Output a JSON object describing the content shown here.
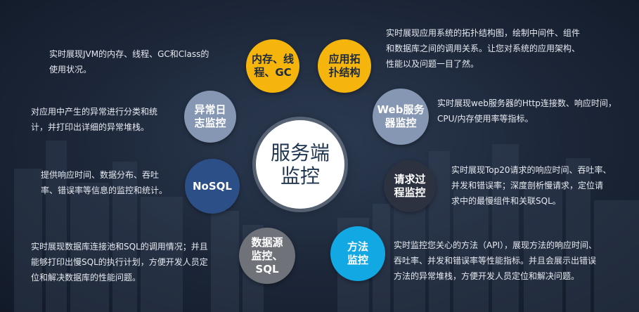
{
  "center": {
    "label": "服务端\n监控"
  },
  "colors": {
    "yellow": "#f5b50c",
    "steel": "#8697b3",
    "navy": "#2d4f88",
    "dark": "#2c3240",
    "cyan": "#12a8e4",
    "gray": "#6f7278"
  },
  "nodes": [
    {
      "id": "memory",
      "label": "内存、线\n程、GC",
      "color": "yellow",
      "text_color": "#1d2a3c",
      "desc": "实时展现JVM的内存、线程、GC和Class的\n使用状况。"
    },
    {
      "id": "topology",
      "label": "应用拓\n扑结构",
      "color": "yellow",
      "text_color": "#1d2a3c",
      "desc": "实时展现应用系统的拓扑结构图，绘制中间件、组件\n和数据库之间的调用关系。让您对系统的应用架构、\n性能以及问题一目了然。"
    },
    {
      "id": "exception-log",
      "label": "异常日\n志监控",
      "color": "steel",
      "text_color": "#ffffff",
      "desc": "对应用中产生的异常进行分类和统\n计，并打印出详细的异常堆栈。"
    },
    {
      "id": "web-server",
      "label": "Web服务\n器监控",
      "color": "steel",
      "text_color": "#ffffff",
      "desc": "实时展现web服务器的Http连接数、响应时间，\nCPU/内存使用率等指标。"
    },
    {
      "id": "nosql",
      "label": "NoSQL",
      "color": "navy",
      "text_color": "#ffffff",
      "desc": "提供响应时间、数据分布、吞吐\n率、错误率等信息的监控和统计。"
    },
    {
      "id": "request-process",
      "label": "请求过\n程监控",
      "color": "dark",
      "text_color": "#ffffff",
      "desc": "实时展现Top20请求的响应时间、吞吐率、\n并发和错误率；深度剖析慢请求，定位请\n求中的最慢组件和关联SQL。"
    },
    {
      "id": "datasource",
      "label": "数据源\n监控、\nSQL",
      "color": "gray",
      "text_color": "#ffffff",
      "desc": "实时展现数据库连接池和SQL的调用情况；并且\n能够打印出慢SQL的执行计划，方便开发人员定\n位和解决数据库的性能问题。"
    },
    {
      "id": "method",
      "label": "方法\n监控",
      "color": "cyan",
      "text_color": "#ffffff",
      "desc": "实时监控您关心的方法（API），展现方法的响应时间、\n吞吐率、并发和错误率等性能指标。并且会展示出错误\n方法的异常堆栈，方便开发人员定位和解决问题。"
    }
  ]
}
